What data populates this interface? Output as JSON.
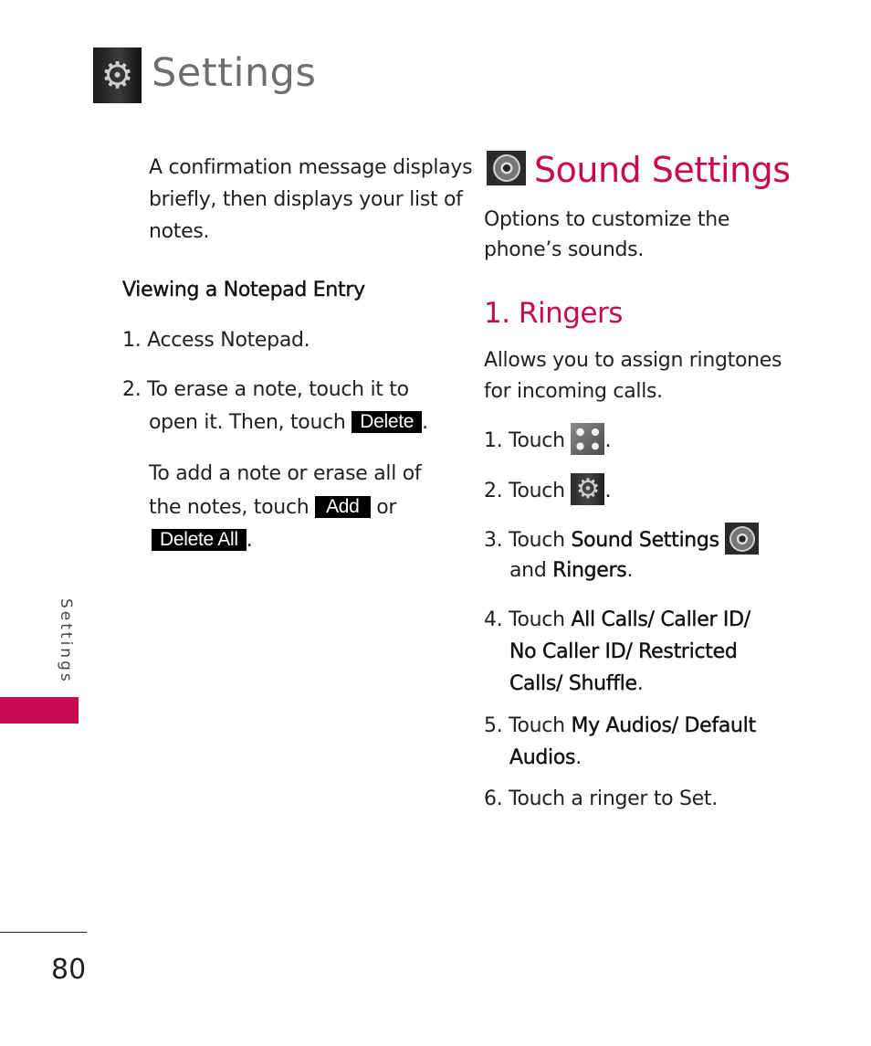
{
  "header": {
    "title": "Settings",
    "icon": "gear-icon"
  },
  "side_tab": {
    "label": "Settings",
    "accent": "#c8094f"
  },
  "footer": {
    "page_number": "80"
  },
  "left_column": {
    "intro": [
      "A confirmation message displays",
      "briefly, then displays your list of",
      "notes."
    ],
    "subheading": "Viewing a Notepad Entry",
    "step1": "1. Access Notepad.",
    "step2_line1": "2. To erase a note, touch it to",
    "step2_line2": "open it. Then, touch",
    "delete_key": "Delete",
    "period": ".",
    "note_line1": "To add a note or erase all of",
    "note_line2": "the notes, touch",
    "add_key": "Add",
    "or_text": "or",
    "delete_all_key": "Delete All"
  },
  "right_column": {
    "section_title": "Sound Settings",
    "section_icon": "speaker-icon",
    "section_desc": [
      "Options to customize the",
      "phone’s sounds."
    ],
    "subsection_title": "1. Ringers",
    "subsection_desc": [
      "Allows you to assign ringtones",
      "for incoming calls."
    ],
    "steps": {
      "s1_prefix": "1. Touch",
      "s1_icon": "menu-grid-icon",
      "s2_prefix": "2. Touch",
      "s2_icon": "gear-icon",
      "s3_prefix": "3. Touch",
      "s3_bold": "Sound Settings",
      "s3_icon": "speaker-icon",
      "s3_and": "and",
      "s3_bold2": "Ringers",
      "s4_prefix": "4. Touch",
      "s4_bold_line1": "All Calls/ Caller ID/",
      "s4_bold_line2": "No Caller ID/ Restricted",
      "s4_bold_line3": "Calls/ Shuffle",
      "s5_prefix": "5. Touch",
      "s5_bold_line1": "My Audios/ Default",
      "s5_bold_line2": "Audios",
      "s6": "6. Touch a ringer to Set."
    },
    "period": "."
  }
}
